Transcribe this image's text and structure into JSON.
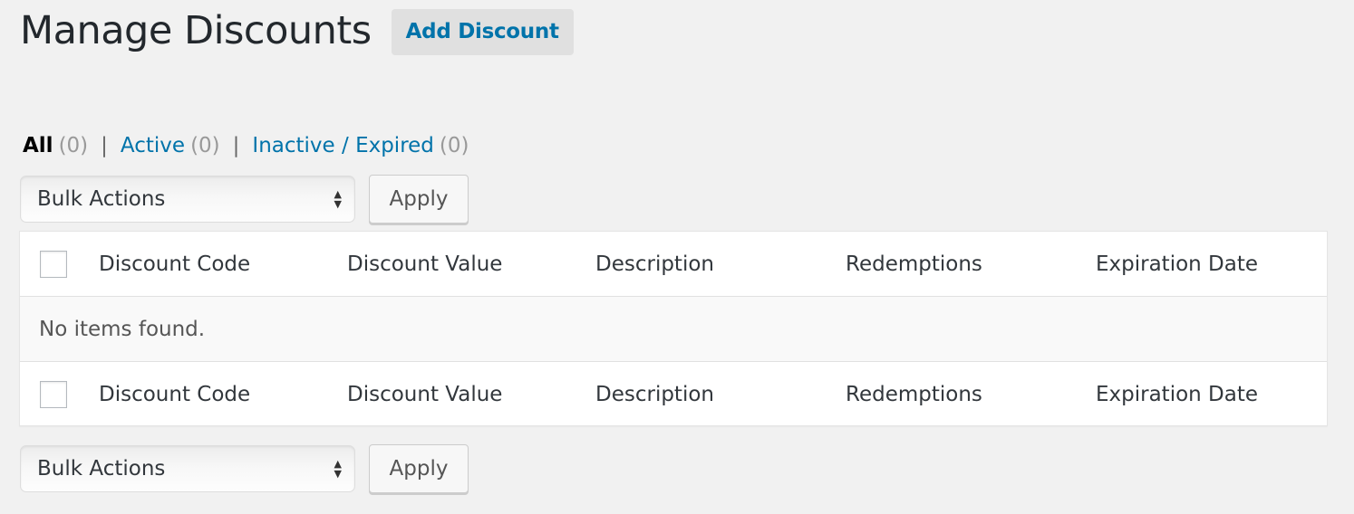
{
  "header": {
    "title": "Manage Discounts",
    "add_button": "Add Discount"
  },
  "filters": [
    {
      "label": "All",
      "count": "(0)",
      "current": true
    },
    {
      "label": "Active",
      "count": "(0)",
      "current": false
    },
    {
      "label": "Inactive / Expired",
      "count": "(0)",
      "current": false
    }
  ],
  "filter_separator": "|",
  "bulk": {
    "select_value": "Bulk Actions",
    "apply_label": "Apply"
  },
  "table": {
    "columns": [
      "Discount Code",
      "Discount Value",
      "Description",
      "Redemptions",
      "Expiration Date"
    ],
    "empty_message": "No items found."
  },
  "colors": {
    "link": "#0073aa",
    "background": "#f1f1f1"
  }
}
